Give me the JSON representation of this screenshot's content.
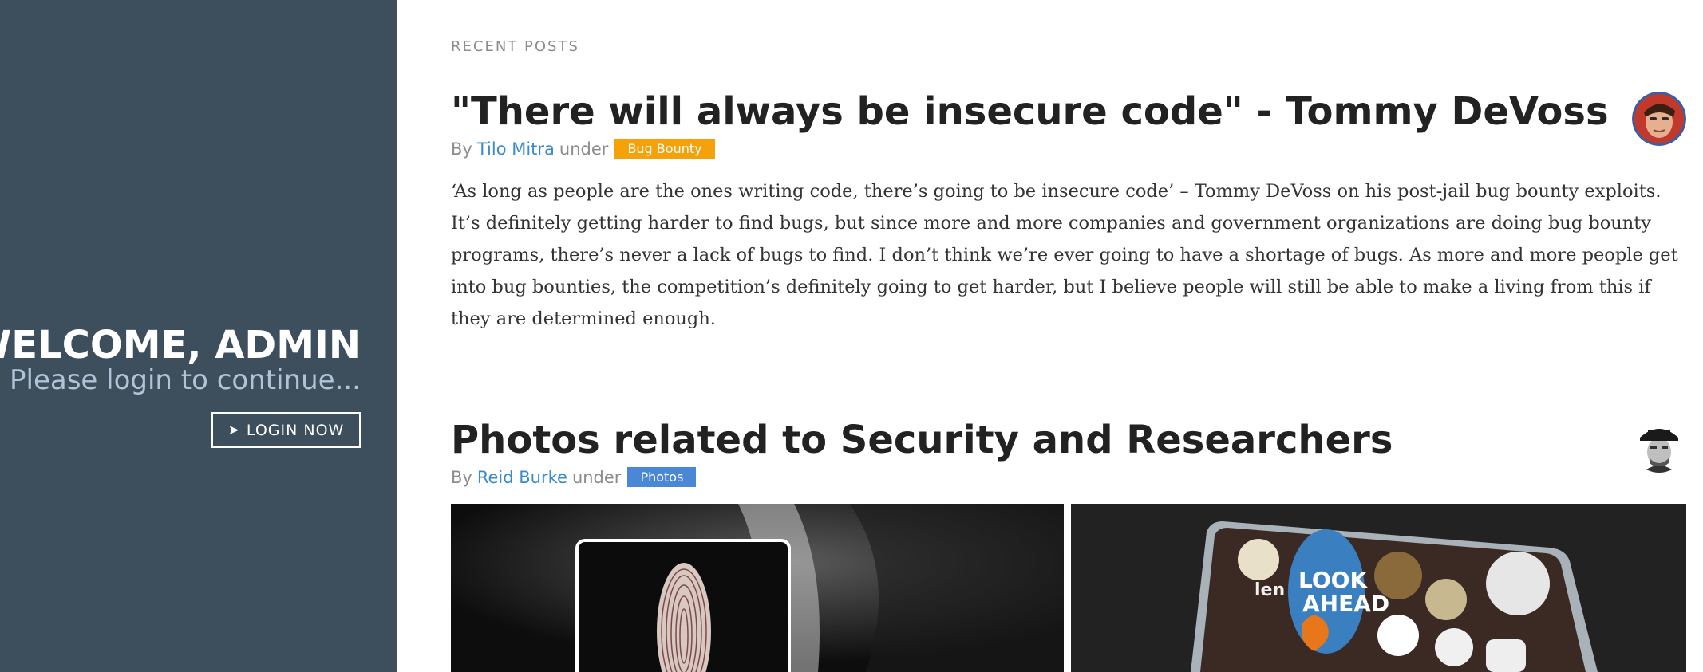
{
  "sidebar": {
    "heading": "WELCOME, ADMIN",
    "tagline": "Please login to continue...",
    "login_button": {
      "icon": "arrow-icon",
      "label": "LOGIN NOW"
    }
  },
  "main": {
    "section_title": "RECENT POSTS",
    "posts": [
      {
        "title": "\"There will always be insecure code\" - Tommy DeVoss",
        "by": "By",
        "author": "Tilo Mitra",
        "under": "under",
        "category": "Bug Bounty",
        "category_color": "#f5a10a",
        "body": "‘As long as people are the ones writing code, there’s going to be insecure code’ – Tommy DeVoss on his post-jail bug bounty exploits. It’s definitely getting harder to find bugs, but since more and more companies and government organizations are doing bug bounty programs, there’s never a lack of bugs to find. I don’t think we’re ever going to have a shortage of bugs. As more and more people get into bug bounties, the competition’s definitely going to get harder, but I believe people will still be able to make a living from this if they are determined enough."
      },
      {
        "title": "Photos related to Security and Researchers",
        "by": "By",
        "author": "Reid Burke",
        "under": "under",
        "category": "Photos",
        "category_color": "#4a87d6"
      }
    ]
  },
  "colors": {
    "sidebar_bg": "#3d4f5d",
    "link": "#3b8bcc",
    "tagline": "#b0c4d7"
  }
}
